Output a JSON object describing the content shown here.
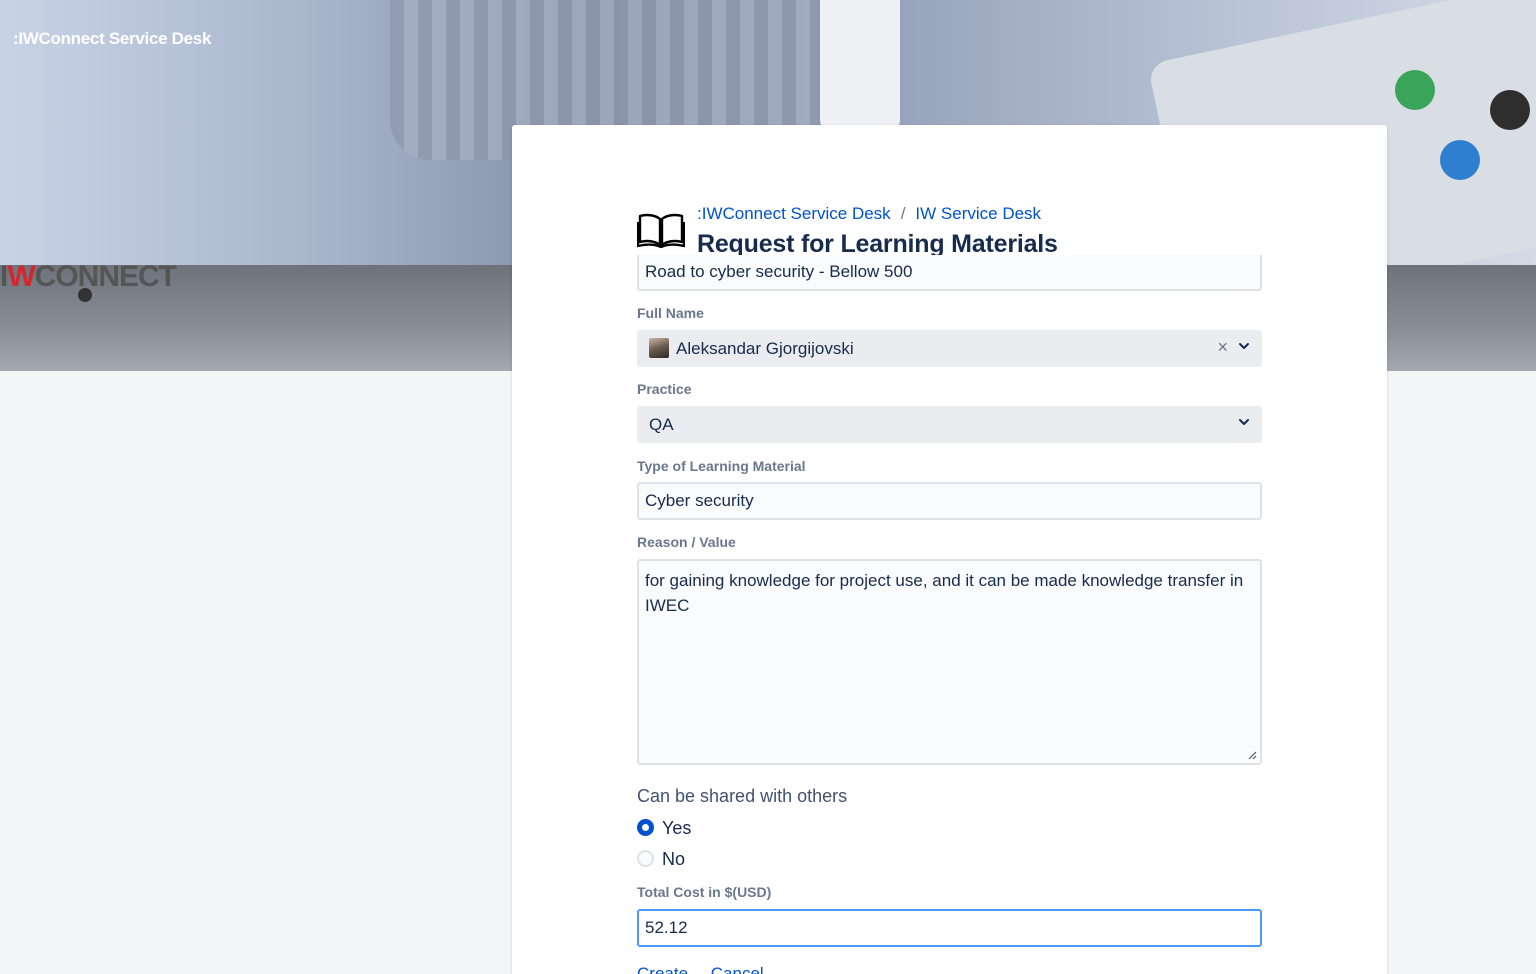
{
  "banner": {
    "brand": ":IWConnect Service Desk",
    "logo_text_i": "I",
    "logo_text_w": "W",
    "logo_text_rest": "CONNECT"
  },
  "header": {
    "breadcrumb": [
      ":IWConnect Service Desk",
      "IW Service Desk"
    ],
    "breadcrumb_separator": "/",
    "title": "Request for Learning Materials",
    "icon": "book-icon"
  },
  "form": {
    "summary_value": "Road to cyber security -  Bellow 500",
    "full_name": {
      "label": "Full Name",
      "value": "Aleksandar Gjorgijovski",
      "clear": "×"
    },
    "practice": {
      "label": "Practice",
      "value": "QA"
    },
    "type": {
      "label": "Type of Learning Material",
      "value": "Cyber security"
    },
    "reason": {
      "label": "Reason / Value",
      "value": "for gaining knowledge for project use, and it can be made knowledge transfer in IWEC"
    },
    "shared": {
      "label": "Can be shared with others",
      "options": [
        "Yes",
        "No"
      ],
      "selected": "Yes"
    },
    "total_cost": {
      "label": "Total Cost in $(USD)",
      "value": "52.12"
    }
  },
  "actions": {
    "create": "Create",
    "cancel": "Cancel"
  },
  "colors": {
    "link": "#0052cc",
    "focus": "#4c9aff",
    "text": "#172b4d",
    "label": "#6b778c"
  }
}
